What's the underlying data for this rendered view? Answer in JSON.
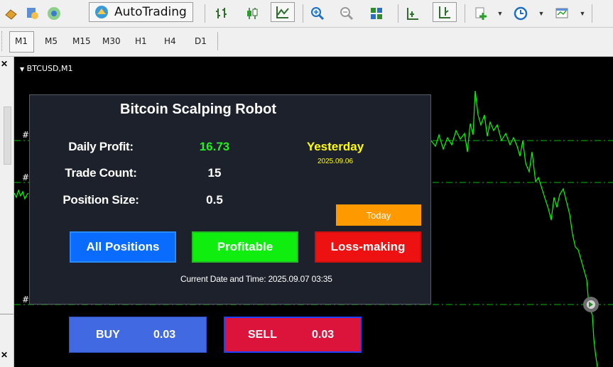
{
  "toolbar": {
    "autotrading_label": "AutoTrading",
    "icons": [
      "pencil-icon",
      "user-icon",
      "signal-icon",
      "autotrading-icon",
      "bar-chart-icon",
      "candlestick-icon",
      "line-chart-icon",
      "zoom-in-icon",
      "zoom-out-icon",
      "tile-windows-icon",
      "chart-shift-icon",
      "autoscroll-icon",
      "indicators-icon",
      "periods-icon",
      "templates-icon"
    ]
  },
  "timeframes": [
    "M1",
    "M5",
    "M15",
    "M30",
    "H1",
    "H4",
    "D1"
  ],
  "chart": {
    "title": "BTCUSD,M1",
    "line_color": "#00ff00",
    "grid_color": "#00c000"
  },
  "panel": {
    "title": "Bitcoin Scalping Robot",
    "daily_profit_label": "Daily Profit:",
    "daily_profit_value": "16.73",
    "trade_count_label": "Trade Count:",
    "trade_count_value": "15",
    "position_size_label": "Position Size:",
    "position_size_value": "0.5",
    "yesterday_label": "Yesterday",
    "yesterday_date": "2025.09.06",
    "today_button": "Today",
    "buttons": {
      "all": "All Positions",
      "profitable": "Profitable",
      "loss": "Loss-making"
    },
    "datetime": "Current Date and Time: 2025.09.07 03:35",
    "colors": {
      "profit": "#22ee22",
      "yesterday": "#ffff00",
      "today_bg": "#ff9900",
      "all_bg": "#0a6cff",
      "profitable_bg": "#10ee10",
      "loss_bg": "#ee1111"
    }
  },
  "trade": {
    "buy_label": "BUY",
    "buy_lot": "0.03",
    "sell_label": "SELL",
    "sell_lot": "0.03",
    "colors": {
      "buy_bg": "#4169e1",
      "sell_bg": "#dc143c"
    }
  }
}
